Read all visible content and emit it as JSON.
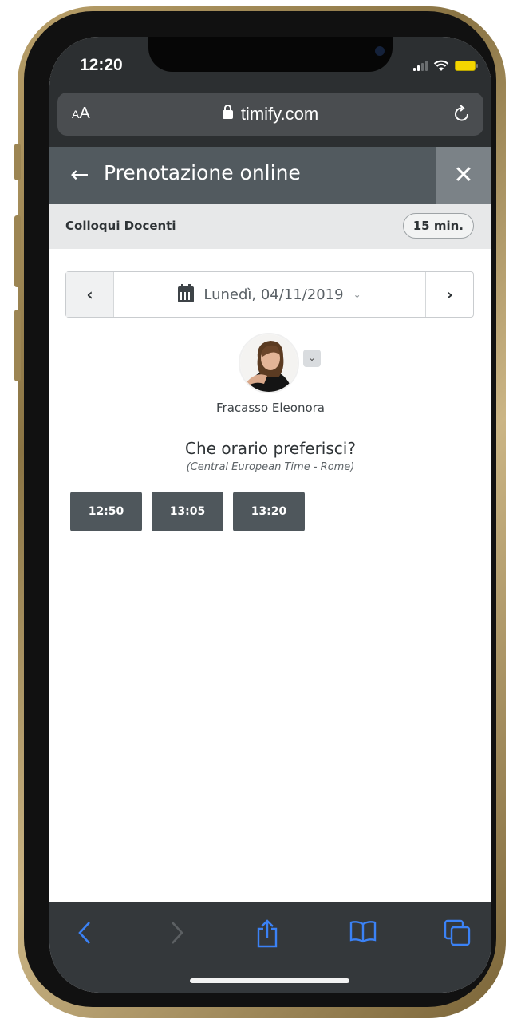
{
  "status_bar": {
    "time": "12:20"
  },
  "browser": {
    "text_size_label_small": "A",
    "text_size_label_large": "A",
    "url": "timify.com"
  },
  "header": {
    "title": "Prenotazione online",
    "back_glyph": "←",
    "close_glyph": "✕"
  },
  "service": {
    "name": "Colloqui Docenti",
    "duration": "15 min."
  },
  "date_nav": {
    "prev_glyph": "‹",
    "next_glyph": "›",
    "date": "Lunedì, 04/11/2019",
    "dropdown_glyph": "⌄"
  },
  "resource": {
    "name": "Fracasso Eleonora",
    "caret_glyph": "⌄"
  },
  "booking": {
    "question": "Che orario preferisci?",
    "timezone": "(Central European Time - Rome)",
    "slots": [
      "12:50",
      "13:05",
      "13:20"
    ]
  },
  "toolbar": {
    "back_icon": "chevron-left-icon",
    "forward_icon": "chevron-right-icon",
    "share_icon": "share-icon",
    "bookmarks_icon": "book-icon",
    "tabs_icon": "tabs-icon"
  },
  "colors": {
    "accent": "#3b82f6",
    "header": "#525a5f",
    "slot": "#4f575c"
  }
}
